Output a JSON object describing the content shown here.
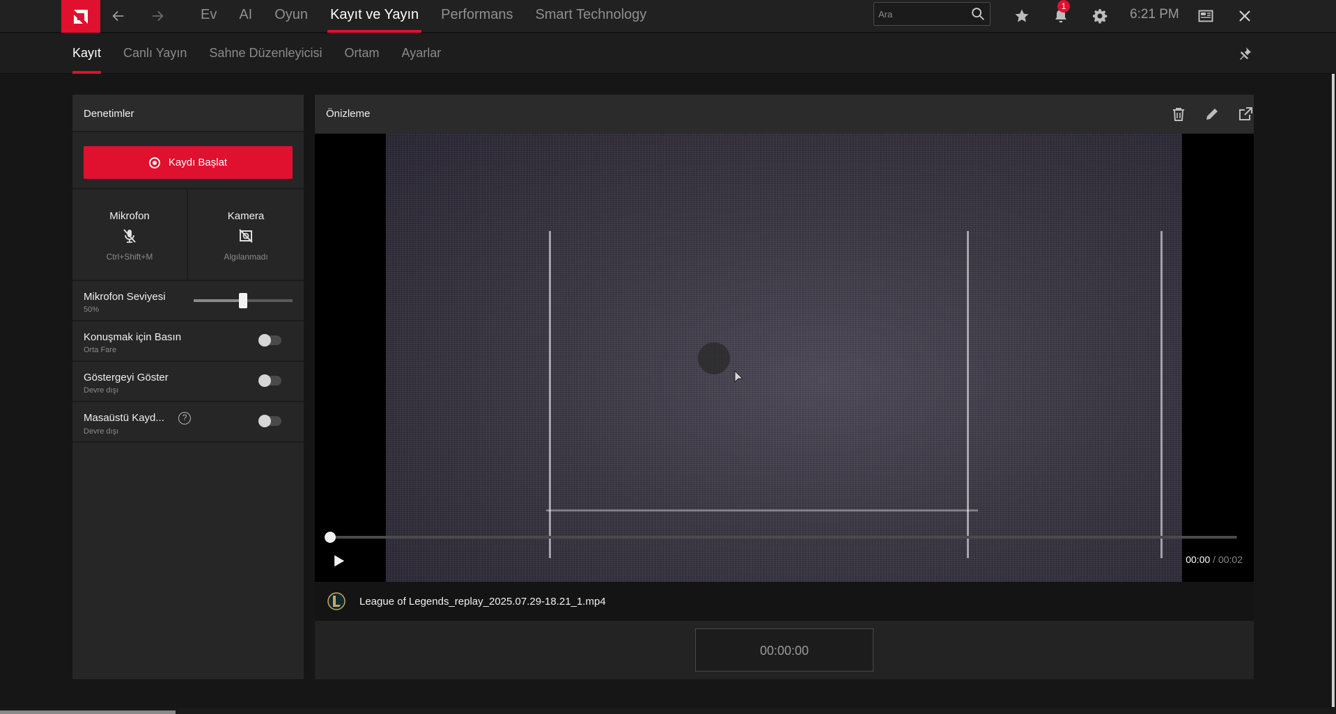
{
  "app": {
    "name": "AMD Software"
  },
  "topbar": {
    "nav": [
      "Ev",
      "AI",
      "Oyun",
      "Kayıt ve Yayın",
      "Performans",
      "Smart Technology"
    ],
    "active_nav_index": 3,
    "search": {
      "placeholder": "Ara",
      "value": ""
    },
    "notification_count": "1",
    "clock": "6:21 PM",
    "icons": [
      "back-arrow-icon",
      "forward-arrow-icon",
      "search-icon",
      "star-icon",
      "bell-icon",
      "gear-icon",
      "layout-icon",
      "close-icon"
    ]
  },
  "subnav": {
    "tabs": [
      "Kayıt",
      "Canlı Yayın",
      "Sahne Düzenleyicisi",
      "Ortam",
      "Ayarlar"
    ],
    "active_tab_index": 0
  },
  "controls": {
    "title": "Denetimler",
    "record_button": "Kaydı Başlat",
    "microphone": {
      "label": "Mikrofon",
      "shortcut": "Ctrl+Shift+M"
    },
    "camera": {
      "label": "Kamera",
      "status": "Algılanmadı"
    },
    "mic_level": {
      "label": "Mikrofon Seviyesi",
      "value_text": "50%",
      "value": 0.5
    },
    "push_to_talk": {
      "label": "Konuşmak için Basın",
      "sub": "Orta Fare",
      "enabled": false
    },
    "show_indicator": {
      "label": "Göstergeyi Göster",
      "sub": "Devre dışı",
      "enabled": false
    },
    "desktop_record": {
      "label": "Masaüstü Kayd...",
      "sub": "Devre dışı",
      "help": "?",
      "enabled": false
    }
  },
  "preview": {
    "title": "Önizleme",
    "current_time": "00:00",
    "separator": " / ",
    "duration": "00:02",
    "progress": 0.0,
    "file_name": "League of Legends_replay_2025.07.29-18.21_1.mp4",
    "timer": "00:00:00"
  },
  "colors": {
    "accent": "#e0102f",
    "background": "#161616",
    "panel": "#262626"
  }
}
